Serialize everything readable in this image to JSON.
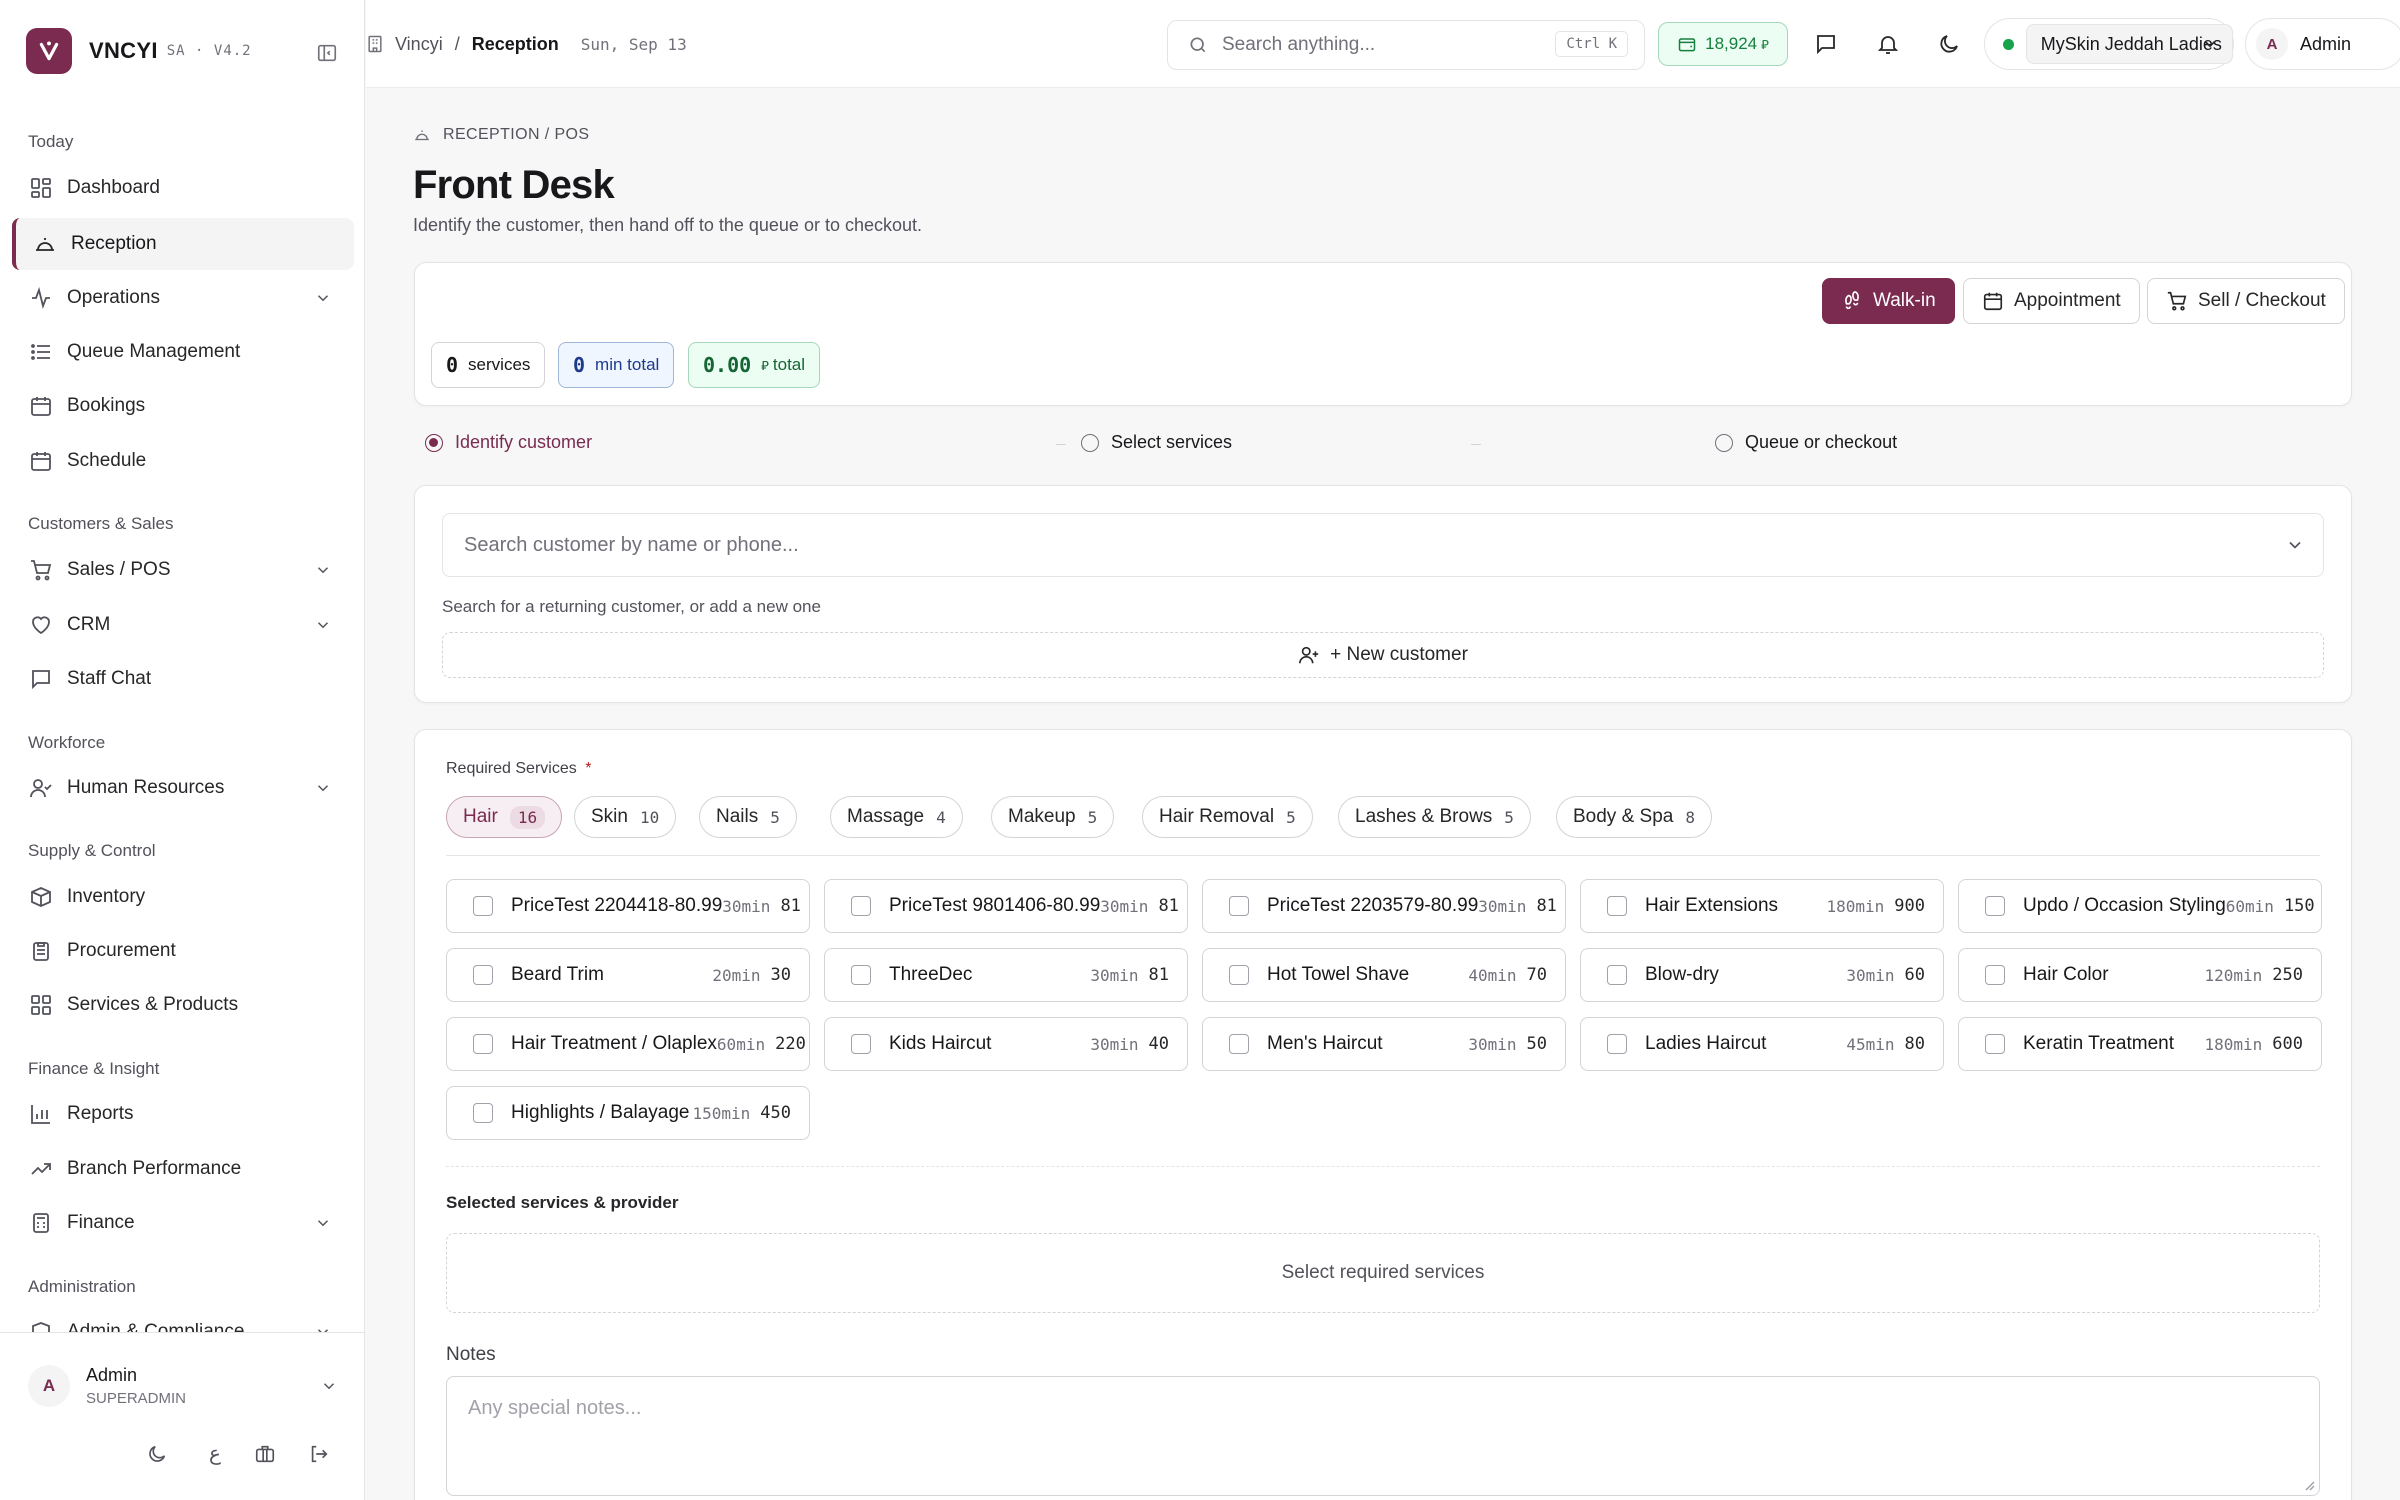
{
  "brand": {
    "name": "VNCYI",
    "version": "SA · V4.2"
  },
  "sidebar": {
    "sections": [
      "Today",
      "Customers & Sales",
      "Workforce",
      "Supply & Control",
      "Finance & Insight",
      "Administration"
    ],
    "items": [
      {
        "label": "Dashboard"
      },
      {
        "label": "Reception"
      },
      {
        "label": "Operations"
      },
      {
        "label": "Queue Management"
      },
      {
        "label": "Bookings"
      },
      {
        "label": "Schedule"
      },
      {
        "label": "Sales / POS"
      },
      {
        "label": "CRM"
      },
      {
        "label": "Staff Chat"
      },
      {
        "label": "Human Resources"
      },
      {
        "label": "Inventory"
      },
      {
        "label": "Procurement"
      },
      {
        "label": "Services & Products"
      },
      {
        "label": "Reports"
      },
      {
        "label": "Branch Performance"
      },
      {
        "label": "Finance"
      },
      {
        "label": "Admin & Compliance"
      }
    ],
    "user": {
      "initial": "A",
      "name": "Admin",
      "role": "SUPERADMIN"
    },
    "lang_glyph": "ع"
  },
  "topbar": {
    "breadcrumb_root": "Vincyi",
    "breadcrumb_sep": "/",
    "breadcrumb_current": "Reception",
    "date": "Sun, Sep 13",
    "search_placeholder": "Search anything...",
    "shortcut": "Ctrl K",
    "balance": "18,924",
    "branch": "MySkin Jeddah Ladies",
    "user_initial": "A",
    "user_name": "Admin"
  },
  "page": {
    "eyebrow": "RECEPTION / POS",
    "title": "Front Desk",
    "subtitle": "Identify the customer, then hand off to the queue or to checkout."
  },
  "actions": {
    "walkin": "Walk-in",
    "appointment": "Appointment",
    "checkout": "Sell / Checkout"
  },
  "summary": {
    "services_count": "0",
    "services_label": "services",
    "min_count": "0",
    "min_label": "min total",
    "total_value": "0.00",
    "total_label": "total"
  },
  "steps": [
    "Identify customer",
    "Select services",
    "Queue or checkout"
  ],
  "customer": {
    "search_placeholder": "Search customer by name or phone...",
    "hint": "Search for a returning customer, or add a new one",
    "new_label": "+ New customer"
  },
  "services": {
    "heading": "Required Services",
    "required_mark": "*",
    "categories": [
      {
        "name": "Hair",
        "count": "16"
      },
      {
        "name": "Skin",
        "count": "10"
      },
      {
        "name": "Nails",
        "count": "5"
      },
      {
        "name": "Massage",
        "count": "4"
      },
      {
        "name": "Makeup",
        "count": "5"
      },
      {
        "name": "Hair Removal",
        "count": "5"
      },
      {
        "name": "Lashes & Brows",
        "count": "5"
      },
      {
        "name": "Body & Spa",
        "count": "8"
      }
    ],
    "items": [
      {
        "name": "PriceTest 2204418-80.99",
        "dur": "30min",
        "price": "81"
      },
      {
        "name": "PriceTest 9801406-80.99",
        "dur": "30min",
        "price": "81"
      },
      {
        "name": "PriceTest 2203579-80.99",
        "dur": "30min",
        "price": "81"
      },
      {
        "name": "Hair Extensions",
        "dur": "180min",
        "price": "900"
      },
      {
        "name": "Updo / Occasion Styling",
        "dur": "60min",
        "price": "150"
      },
      {
        "name": "Beard Trim",
        "dur": "20min",
        "price": "30"
      },
      {
        "name": "ThreeDec",
        "dur": "30min",
        "price": "81"
      },
      {
        "name": "Hot Towel Shave",
        "dur": "40min",
        "price": "70"
      },
      {
        "name": "Blow-dry",
        "dur": "30min",
        "price": "60"
      },
      {
        "name": "Hair Color",
        "dur": "120min",
        "price": "250"
      },
      {
        "name": "Hair Treatment / Olaplex",
        "dur": "60min",
        "price": "220"
      },
      {
        "name": "Kids Haircut",
        "dur": "30min",
        "price": "40"
      },
      {
        "name": "Men's Haircut",
        "dur": "30min",
        "price": "50"
      },
      {
        "name": "Ladies Haircut",
        "dur": "45min",
        "price": "80"
      },
      {
        "name": "Keratin Treatment",
        "dur": "180min",
        "price": "600"
      },
      {
        "name": "Highlights / Balayage",
        "dur": "150min",
        "price": "450"
      }
    ],
    "selected_heading": "Selected services & provider",
    "selected_empty": "Select required services",
    "notes_label": "Notes",
    "notes_placeholder": "Any special notes..."
  },
  "colors": {
    "accent": "#7a2b4f",
    "status_online": "#16a34a",
    "balance_bg": "#ecfdf3"
  }
}
